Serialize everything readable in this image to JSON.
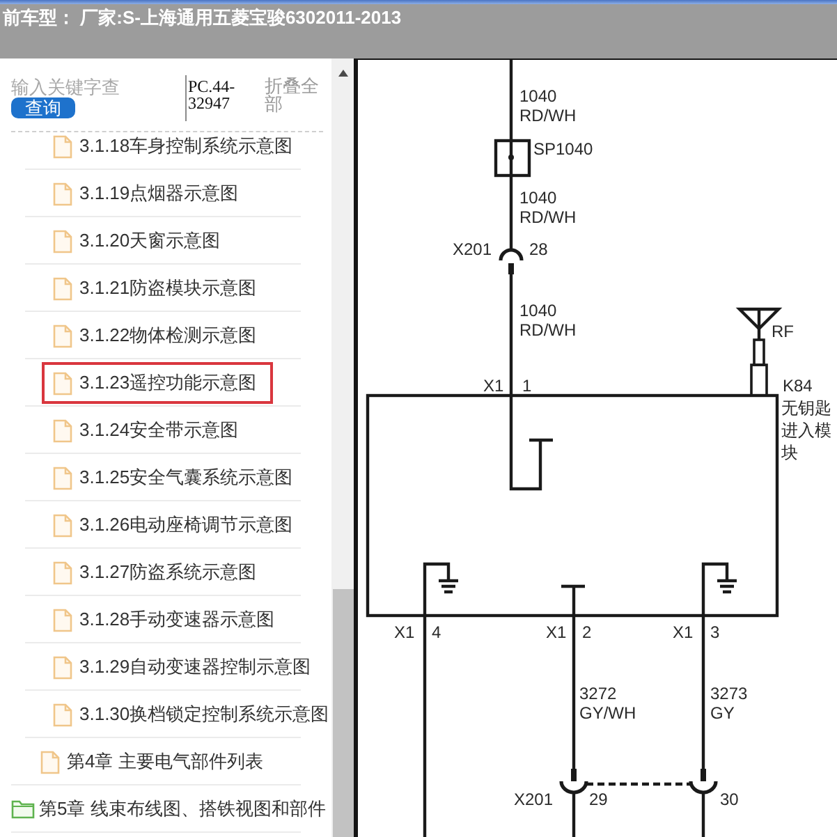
{
  "header": {
    "title": "前车型： 厂家:S-上海通用五菱宝骏6302011-2013"
  },
  "search": {
    "placeholder": "输入关键字查",
    "button": "查询"
  },
  "doc_code": "PC.44-32947",
  "collapse_all": "折叠全部",
  "tree": [
    {
      "children": [
        {
          "children": [
            {
              "label": "3.1.18车身控制系统示意图",
              "kind": "file",
              "selected": false
            },
            {
              "label": "3.1.19点烟器示意图",
              "kind": "file",
              "selected": false
            },
            {
              "label": "3.1.20天窗示意图",
              "kind": "file",
              "selected": false
            },
            {
              "label": "3.1.21防盗模块示意图",
              "kind": "file",
              "selected": false
            },
            {
              "label": "3.1.22物体检测示意图",
              "kind": "file",
              "selected": false
            },
            {
              "label": "3.1.23遥控功能示意图",
              "kind": "file",
              "selected": true
            },
            {
              "label": "3.1.24安全带示意图",
              "kind": "file",
              "selected": false
            },
            {
              "label": "3.1.25安全气囊系统示意图",
              "kind": "file",
              "selected": false
            },
            {
              "label": "3.1.26电动座椅调节示意图",
              "kind": "file",
              "selected": false
            },
            {
              "label": "3.1.27防盗系统示意图",
              "kind": "file",
              "selected": false
            },
            {
              "label": "3.1.28手动变速器示意图",
              "kind": "file",
              "selected": false
            },
            {
              "label": "3.1.29自动变速器控制示意图",
              "kind": "file",
              "selected": false
            },
            {
              "label": "3.1.30换档锁定控制系统示意图",
              "kind": "file",
              "selected": false
            }
          ]
        },
        {
          "label": "第4章 主要电气部件列表",
          "kind": "file",
          "selected": false
        }
      ]
    },
    {
      "label": "第5章 线束布线图、搭铁视图和部件",
      "kind": "folder",
      "selected": false
    }
  ],
  "diagram": {
    "wire_labels": [
      {
        "number": "1040",
        "color_code": "RD/WH"
      },
      {
        "number": "1040",
        "color_code": "RD/WH"
      },
      {
        "number": "1040",
        "color_code": "RD/WH"
      },
      {
        "number": "3272",
        "color_code": "GY/WH"
      },
      {
        "number": "3273",
        "color_code": "GY"
      }
    ],
    "splice": "SP1040",
    "connectors": [
      {
        "name": "X201",
        "pins": [
          "28"
        ]
      },
      {
        "name": "X201",
        "pins": [
          "29",
          "30"
        ]
      }
    ],
    "antenna": "RF",
    "module": {
      "id": "K84",
      "name": "无钥匙进入模块"
    },
    "module_pins": [
      {
        "connector": "X1",
        "pin": "1"
      },
      {
        "connector": "X1",
        "pin": "4"
      },
      {
        "connector": "X1",
        "pin": "2"
      },
      {
        "connector": "X1",
        "pin": "3"
      }
    ]
  }
}
